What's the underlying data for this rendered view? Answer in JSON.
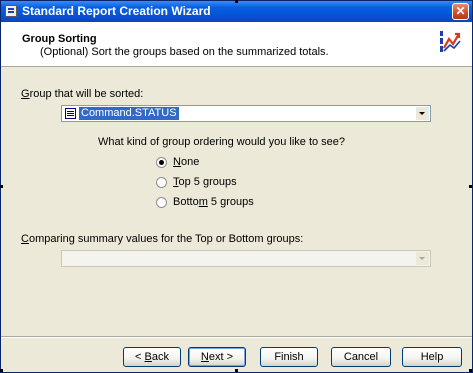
{
  "window": {
    "title": "Standard Report Creation Wizard",
    "close_glyph": "✕"
  },
  "header": {
    "title": "Group Sorting",
    "subtitle": "(Optional) Sort the groups based on the summarized totals.",
    "graphic_icon": "sort-chart-icon"
  },
  "group_field": {
    "label_accel": "G",
    "label_rest": "roup that will be sorted:",
    "value": "Command.STATUS",
    "icon": "field-icon"
  },
  "ordering": {
    "question": "What kind of group ordering would you like to see?",
    "options": [
      {
        "accel": "N",
        "rest": "one",
        "pre": "",
        "checked": true
      },
      {
        "accel": "T",
        "rest": "op 5 groups",
        "pre": "",
        "checked": false
      },
      {
        "accel": "m",
        "rest": " 5 groups",
        "pre": "Botto",
        "checked": false
      }
    ]
  },
  "summary_field": {
    "label_accel": "C",
    "label_rest": "omparing summary values for the Top or Bottom groups:",
    "value": "",
    "enabled": false
  },
  "buttons": {
    "back": {
      "glyph": "<",
      "accel": "B",
      "rest": "ack"
    },
    "next": {
      "accel": "N",
      "rest": "ext",
      "glyph": ">"
    },
    "finish": "Finish",
    "cancel": "Cancel",
    "help": "Help"
  },
  "colors": {
    "title_bar": "#0a5fe0",
    "selection": "#316ac5",
    "dialog_face": "#ece9d8"
  }
}
